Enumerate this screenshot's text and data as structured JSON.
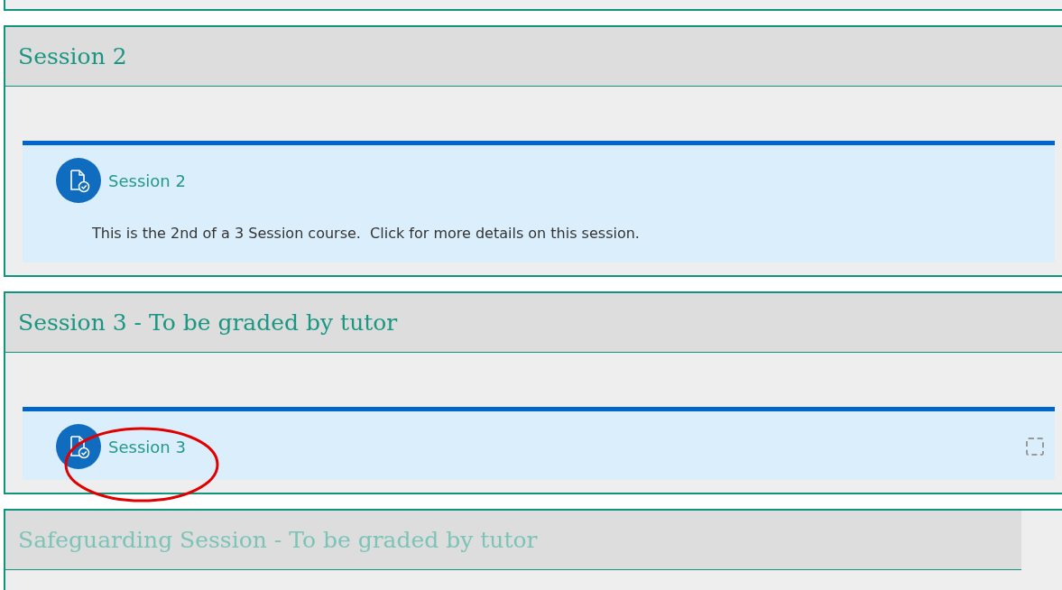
{
  "sections": [
    {
      "title": "Session 2",
      "dimmed": false,
      "activities": [
        {
          "name": "Session 2",
          "description": "This is the 2nd of a 3 Session course.  Click for more details on this session."
        }
      ]
    },
    {
      "title": "Session 3 - To be graded by tutor",
      "dimmed": false,
      "activities": [
        {
          "name": "Session 3",
          "completion": {
            "checked": false
          }
        }
      ]
    },
    {
      "title": "Safeguarding Session - To be graded by tutor",
      "dimmed": true
    }
  ],
  "annotation": {
    "kind": "ellipse"
  }
}
